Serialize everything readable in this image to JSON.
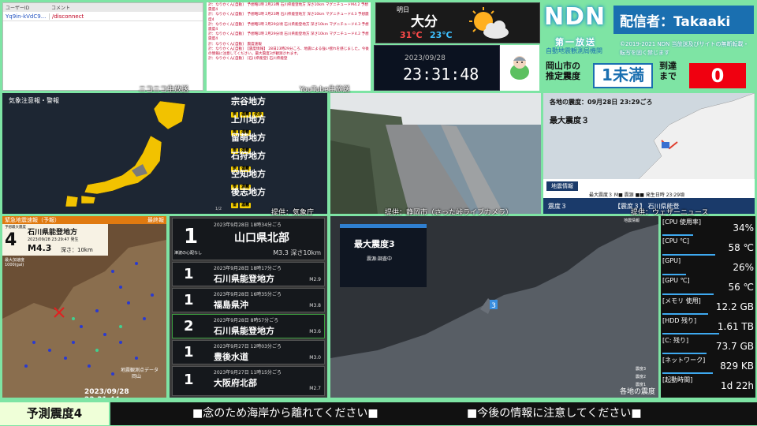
{
  "niko": {
    "col_user": "ユーザーID",
    "col_comment": "コメント",
    "rows": [
      {
        "user": "Yq9in-kVdC9...",
        "comment": "/disconnect"
      }
    ],
    "watermark": "ニコニコ生放送"
  },
  "yt": {
    "watermark": "YouTube生放送",
    "messages": [
      "計：なりかくん[自動]　予想略1時 2月23時 石川県能登地方 深さ10km マグニチュードM4.2 予想震度4",
      "計：なりかくん[自動]　予想略1時 2月23時 石川県能登地方 深さ10km マグニチュード4.3 予想震度4",
      "計：なりかくん[自動]　予想略1時 2月29分頃 石川県能登地方 深さ10km マグニチュード4.3 予想震度4",
      "計：なりかくん[自動]　予想略1時 2月29分頃 石川県能登地方 深さ10km マグニチュード4.2 予想震度4",
      "計：なりかくん[自動]　震度速報",
      "計：なりかくん[自動]　【震度情報】 28日23時29分ころ、地震による強い揺れを感じました。今後の情報に注意してください。最大震度3が観測されます。",
      "計：なりかくん[自動]　[石川県能登] 石川県能登"
    ]
  },
  "weather": {
    "label": "明日",
    "city": "大分",
    "high": "31℃",
    "low": "23℃"
  },
  "clock": {
    "date": "2023/09/28",
    "time": "23:31:48"
  },
  "ndn": {
    "logo": "NDN",
    "host": "配信者：Takaaki",
    "sub1": "第一放送",
    "sub2": "自動地震観測局機関",
    "copyright": "©2019-2021 NDN 当放送及びサイトの無断転載・転写を固く禁じます",
    "city_label1": "岡山市の",
    "city_label2": "推定震度",
    "shindo": "1未満",
    "arrive1": "到達",
    "arrive2": "まで",
    "countdown": "0"
  },
  "warn": {
    "title": "気象注意報・警報",
    "page": "1/2",
    "source": "提供：気象庁",
    "regions": [
      {
        "name": "宗谷地方",
        "tags": [
          "雷",
          "濃霧",
          "波浪"
        ]
      },
      {
        "name": "上川地方",
        "tags": [
          "雷",
          "濃霧"
        ]
      },
      {
        "name": "留萌地方",
        "tags": [
          "雷",
          "濃霧"
        ]
      },
      {
        "name": "石狩地方",
        "tags": [
          "雷",
          "濃霧"
        ]
      },
      {
        "name": "空知地方",
        "tags": [
          "雷",
          "濃霧"
        ]
      },
      {
        "name": "後志地方",
        "tags": [
          "雷",
          "濃霧"
        ]
      }
    ]
  },
  "cam": {
    "source": "提供：静岡市（さった峠ライブカメラ）"
  },
  "kaku": {
    "header": "各地の震度：09月28日 23:29ごろ",
    "max": "最大震度３",
    "info_label": "地震情報",
    "info_line": "最大震度３ M■ 震源 ■■ 発生日時 23:29頃",
    "bottom_left": "震度３",
    "bottom_right": "【震度３】 石川県能登",
    "source": "提供：ウェザーニュース"
  },
  "eew": {
    "bar_left": "緊急地震速報（予報）",
    "bar_right": "最終報",
    "pred_label": "予想最大震度",
    "shindo": "4",
    "epicenter": "石川県能登地方",
    "time": "2023/09/28 23:29:47 発生",
    "mag": "M4.3",
    "depth": "深さ：10km",
    "legend_title": "最大加速度",
    "legend_unit": "1000(gal)",
    "timestamp": "2023/09/28 23:31:44",
    "map_label": "岡山",
    "map_credit": "地震観測点データ"
  },
  "eqlist": [
    {
      "shindo": "1",
      "time": "2023年9月28日 18時34分ごろ",
      "place": "山口県北部",
      "mag": "M3.3 深さ10km",
      "note": "津波の心配なし"
    },
    {
      "shindo": "1",
      "time": "2023年9月28日 18時17分ごろ",
      "place": "石川県能登地方",
      "mag": "M2.9"
    },
    {
      "shindo": "1",
      "time": "2023年9月28日 16時35分ごろ",
      "place": "福島県沖",
      "mag": "M3.8"
    },
    {
      "shindo": "2",
      "time": "2023年9月28日 8時57分ごろ",
      "place": "石川県能登地方",
      "mag": "M3.6"
    },
    {
      "shindo": "1",
      "time": "2023年9月27日 12時03分ごろ",
      "place": "豊後水道",
      "mag": "M3.0"
    },
    {
      "shindo": "1",
      "time": "2023年9月27日 11時15分ごろ",
      "place": "大阪府北部",
      "mag": "M2.7"
    }
  ],
  "bigmap": {
    "title": "地震情報",
    "max": "最大震度3",
    "status": "震源:調査中",
    "legend3": "震度3",
    "legend2": "震度2",
    "legend1": "震度1",
    "caption": "各地の震度"
  },
  "sys": [
    {
      "label": "[CPU 使用率]",
      "value": "34%",
      "fill": 0.34
    },
    {
      "label": "[CPU ℃]",
      "value": "58 ℃",
      "fill": 0.58
    },
    {
      "label": "[GPU]",
      "value": "26%",
      "fill": 0.26
    },
    {
      "label": "[GPU ℃]",
      "value": "56 ℃",
      "fill": 0.56
    },
    {
      "label": "[メモリ 使用]",
      "value": "12.2 GB",
      "fill": 0.5
    },
    {
      "label": "[HDD 残り]",
      "value": "1.61 TB",
      "fill": 0.62
    },
    {
      "label": "[C: 残り]",
      "value": "73.7 GB",
      "fill": 0.48
    },
    {
      "label": "[ネットワーク]",
      "value": "829 KB",
      "fill": 0.55
    },
    {
      "label": "[起動時間]",
      "value": "1d 22h",
      "fill": 0
    }
  ],
  "bottom": {
    "pred": "予測震度4",
    "ticker1": "■念のため海岸から離れてください■",
    "ticker2": "■今後の情報に注意してください■"
  }
}
